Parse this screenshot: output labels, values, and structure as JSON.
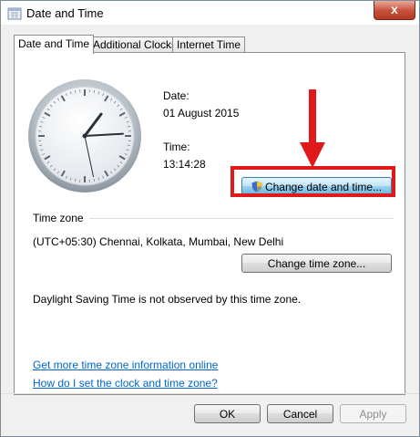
{
  "window": {
    "title": "Date and Time",
    "close_symbol": "x"
  },
  "tabs": [
    {
      "label": "Date and Time",
      "active": true
    },
    {
      "label": "Additional Clocks",
      "active": false
    },
    {
      "label": "Internet Time",
      "active": false
    }
  ],
  "clock": {
    "hour": 13,
    "minute": 14,
    "second": 28
  },
  "date": {
    "label": "Date:",
    "value": "01 August 2015"
  },
  "time": {
    "label": "Time:",
    "value": "13:14:28"
  },
  "change_datetime_button": {
    "label": "Change date and time...",
    "icon": "uac-shield-icon"
  },
  "time_zone": {
    "heading": "Time zone",
    "value": "(UTC+05:30) Chennai, Kolkata, Mumbai, New Delhi",
    "button_label": "Change time zone...",
    "dst_note": "Daylight Saving Time is not observed by this time zone."
  },
  "links": [
    "Get more time zone information online",
    "How do I set the clock and time zone?"
  ],
  "footer": {
    "ok": "OK",
    "cancel": "Cancel",
    "apply": "Apply"
  },
  "colors": {
    "highlight": "#e01a1a",
    "link": "#0066cc",
    "focus_button": "#98d1ef"
  }
}
